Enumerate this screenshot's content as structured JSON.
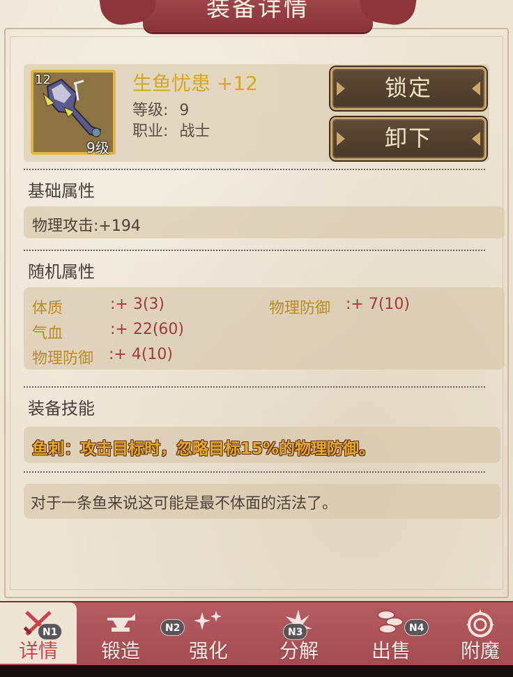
{
  "title": "装备详情",
  "item": {
    "name": "生鱼忧患 +12",
    "enhance_label": "12",
    "required_level_label": "9级",
    "level_label": "等级:",
    "level_value": "9",
    "class_label": "职业:",
    "class_value": "战士"
  },
  "buttons": {
    "lock": "锁定",
    "unequip": "卸下"
  },
  "sections": {
    "base": {
      "title": "基础属性",
      "stats": [
        "物理攻击:+194"
      ]
    },
    "random": {
      "title": "随机属性",
      "stats": [
        {
          "label": "体质",
          "value": ":+ 3(3)"
        },
        {
          "label": "物理防御",
          "value": ":+ 7(10)"
        },
        {
          "label": "气血",
          "value": ":+ 22(60)"
        },
        {
          "label": "物理防御",
          "value": ":+ 4(10)"
        }
      ]
    },
    "skill": {
      "title": "装备技能",
      "text": "鱼刺：攻击目标时，忽略目标15%的物理防御。"
    },
    "flavor": "对于一条鱼来说这可能是最不体面的活法了。"
  },
  "nav": {
    "tabs": [
      {
        "label": "详情",
        "icon": "crossed-swords-icon",
        "active": true
      },
      {
        "label": "锻造",
        "icon": "anvil-icon"
      },
      {
        "label": "强化",
        "icon": "sparkle-icon"
      },
      {
        "label": "分解",
        "icon": "shatter-icon"
      },
      {
        "label": "出售",
        "icon": "coins-icon"
      },
      {
        "label": "附魔",
        "icon": "magic-circle-icon"
      }
    ],
    "badges": [
      "N1",
      "N2",
      "N3",
      "N4"
    ]
  },
  "colors": {
    "accent_gold": "#d4a62a",
    "ribbon_red": "#a34a4e",
    "stat_red": "#a33a33",
    "stat_gold": "#b88c22",
    "button_brown": "#4a3a29"
  }
}
